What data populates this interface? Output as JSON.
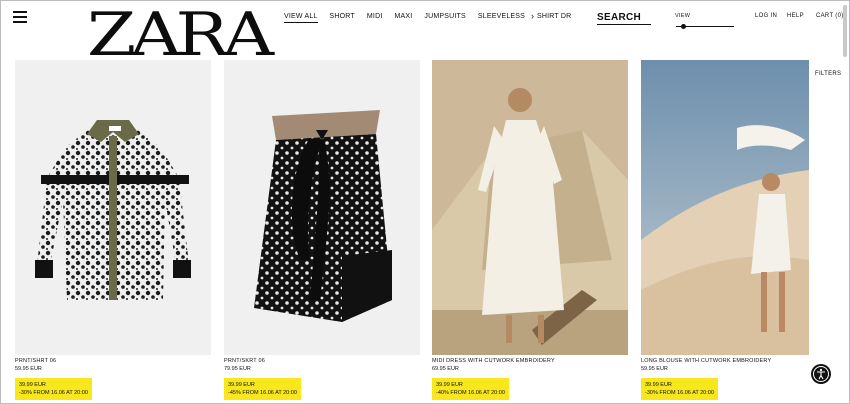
{
  "header": {
    "logo_text": "ZARA",
    "tabs": [
      {
        "label": "VIEW ALL",
        "active": true
      },
      {
        "label": "SHORT"
      },
      {
        "label": "MIDI"
      },
      {
        "label": "MAXI"
      },
      {
        "label": "JUMPSUITS"
      },
      {
        "label": "SLEEVELESS"
      },
      {
        "label": "SHIRT DR"
      }
    ],
    "nav_arrow": "›",
    "search_label": "SEARCH",
    "view_label": "VIEW",
    "view_level": 0.1,
    "login_label": "LOG IN",
    "help_label": "HELP",
    "cart_label": "CART (0)"
  },
  "filters_label": "FILTERS",
  "products": [
    {
      "name": "PRNT/SHRT 06",
      "price": "59.95 EUR",
      "sale_price": "39.99 EUR",
      "sale_note": "-30% FROM 16.06 AT 20:00"
    },
    {
      "name": "PRNT/SKRT 06",
      "price": "79.95 EUR",
      "sale_price": "39.99 EUR",
      "sale_note": "-45% FROM 16.06 AT 20:00"
    },
    {
      "name": "MIDI DRESS WITH CUTWORK EMBROIDERY",
      "price": "69.95 EUR",
      "sale_price": "39.99 EUR",
      "sale_note": "-40% FROM 16.06 AT 20:00"
    },
    {
      "name": "LONG BLOUSE WITH CUTWORK EMBROIDERY",
      "price": "59.95 EUR",
      "sale_price": "39.99 EUR",
      "sale_note": "-30% FROM 16.06 AT 20:00"
    }
  ],
  "colors": {
    "sale_highlight": "#f8e71c",
    "text": "#111111"
  }
}
